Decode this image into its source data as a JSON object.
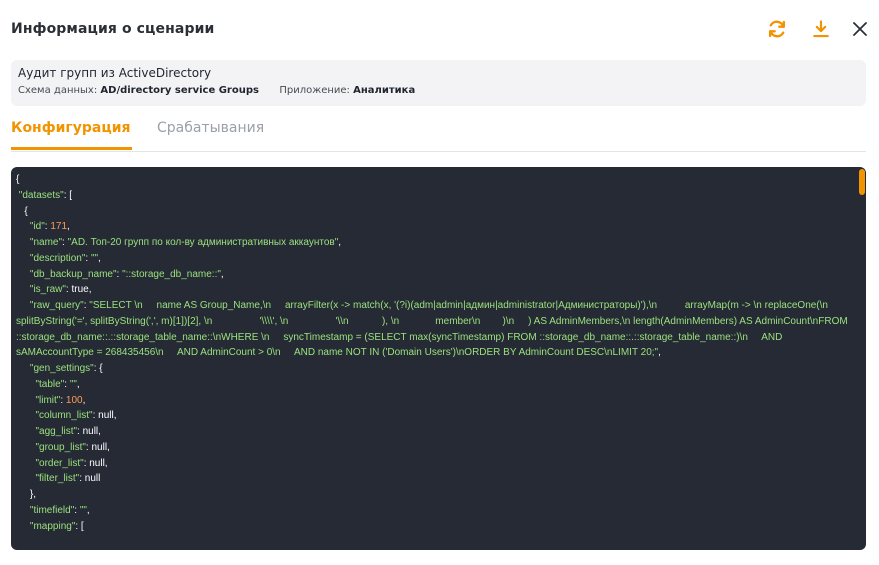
{
  "header": {
    "title": "Информация о сценарии",
    "icons": [
      "refresh-icon",
      "download-icon",
      "close-icon"
    ],
    "accent_color": "#f29300"
  },
  "scenario": {
    "name": "Аудит групп из ActiveDirectory",
    "schema_label": "Схема данных:",
    "schema_value": "AD/directory service Groups",
    "app_label": "Приложение:",
    "app_value": "Аналитика"
  },
  "tabs": [
    {
      "label": "Конфигурация",
      "active": true
    },
    {
      "label": "Срабатывания",
      "active": false
    }
  ],
  "code": {
    "background": "#252a35",
    "lines": [
      [
        {
          "t": "{",
          "c": "w"
        }
      ],
      [
        {
          "t": " \"datasets\"",
          "c": "k"
        },
        {
          "t": ": [",
          "c": "w"
        }
      ],
      [
        {
          "t": "   {",
          "c": "w"
        }
      ],
      [
        {
          "t": "     \"id\"",
          "c": "k"
        },
        {
          "t": ": ",
          "c": "w"
        },
        {
          "t": "171",
          "c": "n"
        },
        {
          "t": ",",
          "c": "w"
        }
      ],
      [
        {
          "t": "     \"name\"",
          "c": "k"
        },
        {
          "t": ": ",
          "c": "w"
        },
        {
          "t": "\"AD. Топ-20 групп по кол-ву административных аккаунтов\"",
          "c": "s"
        },
        {
          "t": ",",
          "c": "w"
        }
      ],
      [
        {
          "t": "     \"description\"",
          "c": "k"
        },
        {
          "t": ": ",
          "c": "w"
        },
        {
          "t": "\"\"",
          "c": "s"
        },
        {
          "t": ",",
          "c": "w"
        }
      ],
      [
        {
          "t": "     \"db_backup_name\"",
          "c": "k"
        },
        {
          "t": ": ",
          "c": "w"
        },
        {
          "t": "\"::storage_db_name::\"",
          "c": "s"
        },
        {
          "t": ",",
          "c": "w"
        }
      ],
      [
        {
          "t": "     \"is_raw\"",
          "c": "k"
        },
        {
          "t": ": true,",
          "c": "w"
        }
      ],
      [
        {
          "t": "     \"raw_query\"",
          "c": "k"
        },
        {
          "t": ": ",
          "c": "w"
        },
        {
          "t": "\"SELECT \\n     name AS Group_Name,\\n     arrayFilter(x -> match(x, '(?i)(adm|admin|админ|administrator|Администраторы)'),\\n          arrayMap(m -> \\n replaceOne(\\n                 splitByString('=', splitByString(',', m)[1])[2], \\n                 '\\\\\\\\', \\n                 '\\\\n            ), \\n             member\\n        )\\n     ) AS AdminMembers,\\n length(AdminMembers) AS AdminCount\\nFROM ::storage_db_name::.::storage_table_name::\\nWHERE \\n     syncTimestamp = (SELECT max(syncTimestamp) FROM ::storage_db_name::.::storage_table_name::)\\n     AND sAMAccountType = 268435456\\n     AND AdminCount > 0\\n     AND name NOT IN ('Domain Users')\\nORDER BY AdminCount DESC\\nLIMIT 20;\"",
          "c": "s"
        },
        {
          "t": ",",
          "c": "w"
        }
      ],
      [
        {
          "t": "     \"gen_settings\"",
          "c": "k"
        },
        {
          "t": ": {",
          "c": "w"
        }
      ],
      [
        {
          "t": "       \"table\"",
          "c": "k"
        },
        {
          "t": ": ",
          "c": "w"
        },
        {
          "t": "\"\"",
          "c": "s"
        },
        {
          "t": ",",
          "c": "w"
        }
      ],
      [
        {
          "t": "       \"limit\"",
          "c": "k"
        },
        {
          "t": ": ",
          "c": "w"
        },
        {
          "t": "100",
          "c": "n"
        },
        {
          "t": ",",
          "c": "w"
        }
      ],
      [
        {
          "t": "       \"column_list\"",
          "c": "k"
        },
        {
          "t": ": null,",
          "c": "w"
        }
      ],
      [
        {
          "t": "       \"agg_list\"",
          "c": "k"
        },
        {
          "t": ": null,",
          "c": "w"
        }
      ],
      [
        {
          "t": "       \"group_list\"",
          "c": "k"
        },
        {
          "t": ": null,",
          "c": "w"
        }
      ],
      [
        {
          "t": "       \"order_list\"",
          "c": "k"
        },
        {
          "t": ": null,",
          "c": "w"
        }
      ],
      [
        {
          "t": "       \"filter_list\"",
          "c": "k"
        },
        {
          "t": ": null",
          "c": "w"
        }
      ],
      [
        {
          "t": "     },",
          "c": "w"
        }
      ],
      [
        {
          "t": "     \"timefield\"",
          "c": "k"
        },
        {
          "t": ": ",
          "c": "w"
        },
        {
          "t": "\"\"",
          "c": "s"
        },
        {
          "t": ",",
          "c": "w"
        }
      ],
      [
        {
          "t": "     \"mapping\"",
          "c": "k"
        },
        {
          "t": ": [",
          "c": "w"
        }
      ]
    ]
  }
}
